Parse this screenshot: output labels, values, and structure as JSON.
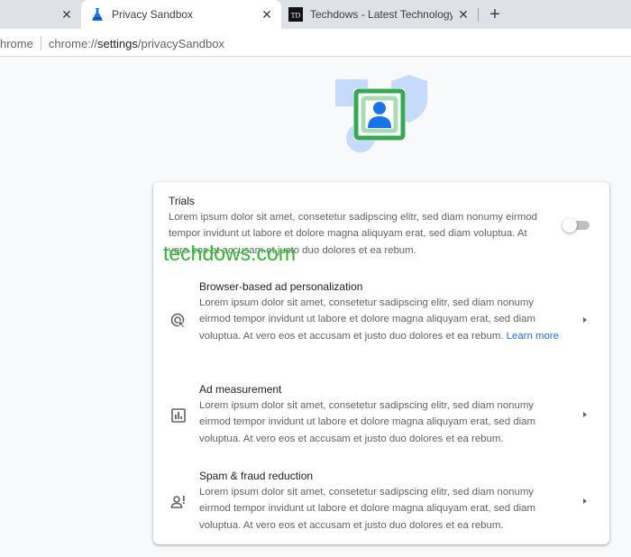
{
  "tabs": [
    {
      "title": "Privacy Sandbox",
      "active": true,
      "favicon": "flask-icon"
    },
    {
      "title": "Techdows - Latest Technology News",
      "active": false,
      "favicon": "td-logo-icon"
    }
  ],
  "omnibox": {
    "chip": "hrome",
    "url_prefix": "chrome://",
    "url_host": "settings",
    "url_path": "/privacySandbox"
  },
  "watermark": "techdows.com",
  "trials": {
    "title": "Trials",
    "description": "Lorem ipsum dolor sit amet, consetetur sadipscing elitr, sed diam nonumy eirmod tempor invidunt ut labore et dolore magna aliquyam erat, sed diam voluptua. At vero eos et accusam et justo duo dolores et ea rebum.",
    "enabled": false
  },
  "rows": [
    {
      "title": "Browser-based ad personalization",
      "icon": "ad-personalization-icon",
      "description": "Lorem ipsum dolor sit amet, consetetur sadipscing elitr, sed diam nonumy eirmod tempor invidunt ut labore et dolore magna aliquyam erat, sed diam voluptua. At vero eos et accusam et justo duo dolores et ea rebum.",
      "link": "Learn more"
    },
    {
      "title": "Ad measurement",
      "icon": "bar-chart-icon",
      "description": "Lorem ipsum dolor sit amet, consetetur sadipscing elitr, sed diam nonumy eirmod tempor invidunt ut labore et dolore magna aliquyam erat, sed diam voluptua. At vero eos et accusam et justo duo dolores et ea rebum."
    },
    {
      "title": "Spam & fraud reduction",
      "icon": "person-alert-icon",
      "description": "Lorem ipsum dolor sit amet, consetetur sadipscing elitr, sed diam nonumy eirmod tempor invidunt ut labore et dolore magna aliquyam erat, sed diam voluptua. At vero eos et accusam et justo duo dolores et ea rebum."
    }
  ],
  "colors": {
    "accent": "#1a73e8",
    "hero_green": "#34a853",
    "hero_blue": "#1a73e8",
    "watermark": "#2eb82e"
  }
}
